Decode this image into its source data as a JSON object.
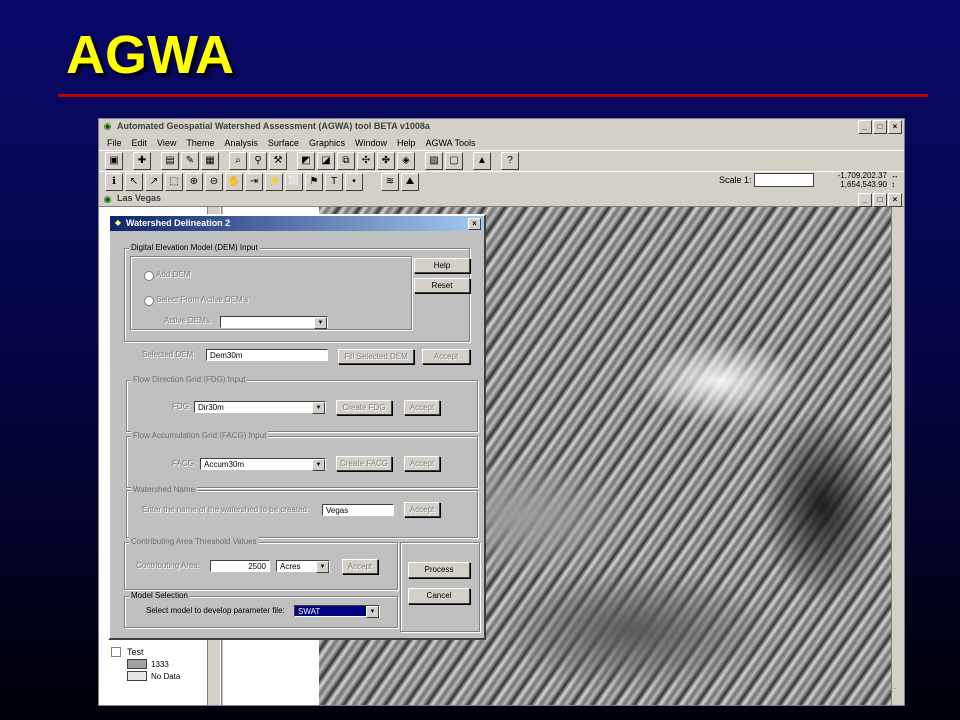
{
  "slide": {
    "title": "AGWA"
  },
  "app": {
    "title": "Automated Geospatial Watershed Assessment (AGWA) tool BETA v1008a",
    "menu": [
      "File",
      "Edit",
      "View",
      "Theme",
      "Analysis",
      "Surface",
      "Graphics",
      "Window",
      "Help",
      "AGWA Tools"
    ],
    "scale_label": "Scale 1:",
    "scale_value": "",
    "coord_x": "-1,709,202.37",
    "coord_y": "1,654,543.90",
    "coord_x_arrow": "↔",
    "coord_y_arrow": "↕",
    "doc_title": "Las Vegas",
    "toc": {
      "layer_name": "Test",
      "legend": [
        {
          "label": "1333",
          "color": "#a0a0a0"
        },
        {
          "label": "No Data",
          "color": "#e6e6e6"
        }
      ]
    }
  },
  "dialog": {
    "title": "Watershed Delineation 2",
    "dem_group": {
      "label": "Digital Elevation Model (DEM) Input",
      "add_dem": "Add DEM",
      "select_active": "Select From Active DEM's",
      "active_dems_label": "Active DEMs:",
      "active_dems_value": "",
      "help": "Help",
      "reset": "Reset",
      "selected_label": "Selected DEM:",
      "selected_value": "Dem30m",
      "fill_button": "Fill Selected DEM",
      "accept": "Accept"
    },
    "fdg_group": {
      "label": "Flow Direction Grid (FDG) Input",
      "field_label": "FDG:",
      "value": "Dir30m",
      "create": "Create FDG",
      "accept": "Accept"
    },
    "facg_group": {
      "label": "Flow Accumulation Grid (FACG) Input",
      "field_label": "FACG:",
      "value": "Accum30m",
      "create": "Create FACG",
      "accept": "Accept"
    },
    "name_group": {
      "label": "Watershed Name",
      "prompt": "Enter the name of the watershed to be created:",
      "value": "Vegas",
      "accept": "Accept"
    },
    "threshold_group": {
      "label": "Contributing Area Threshold Values",
      "field_label": "Contributing Area:",
      "value": "2500",
      "units": "Acres",
      "accept": "Accept"
    },
    "model_group": {
      "label": "Model Selection",
      "prompt": "Select model to develop parameter file:",
      "value": "SWAT"
    },
    "process": "Process",
    "cancel": "Cancel"
  }
}
